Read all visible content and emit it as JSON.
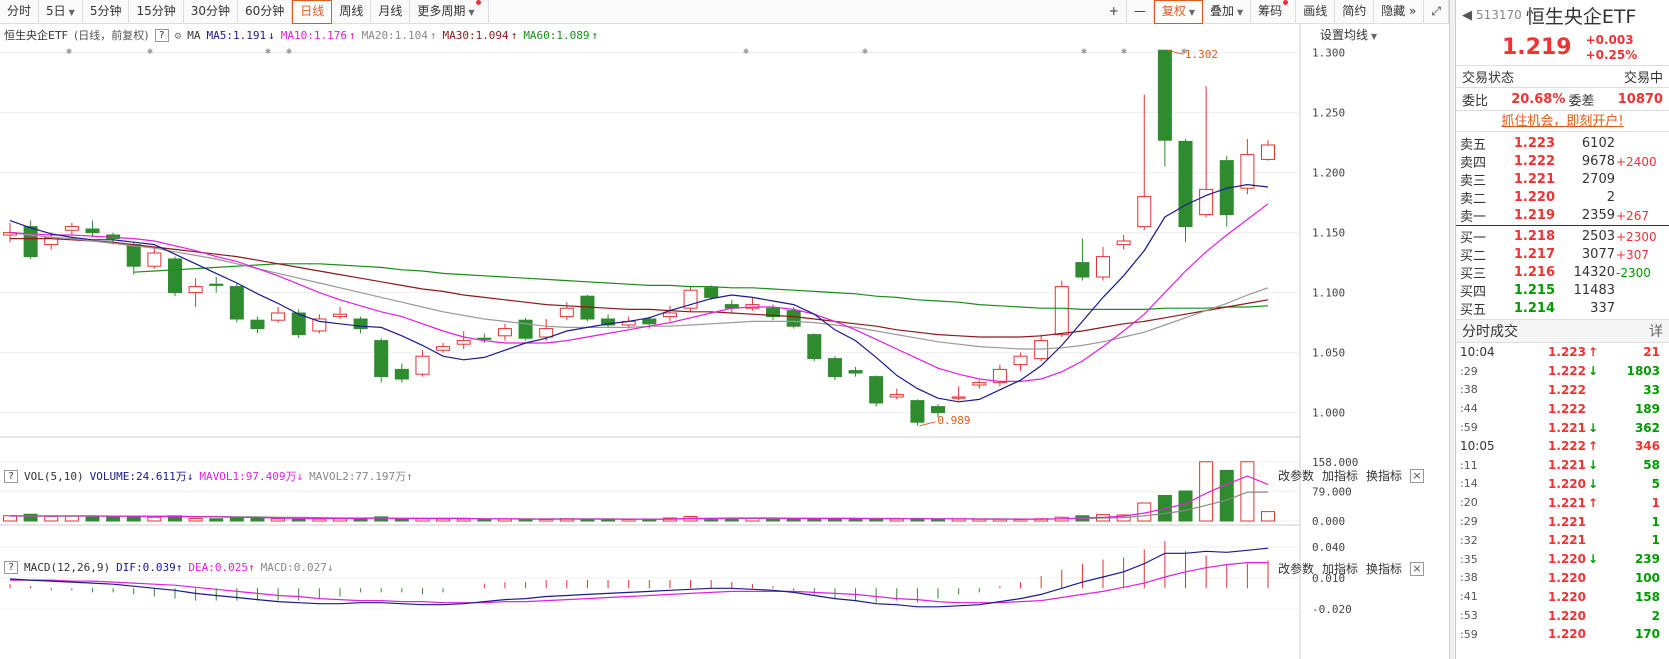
{
  "toolbar": {
    "periods": [
      "分时",
      "5日",
      "5分钟",
      "15分钟",
      "30分钟",
      "60分钟",
      "日线",
      "周线",
      "月线",
      "更多周期"
    ],
    "active_period": "日线",
    "right_buttons": [
      "+",
      "—",
      "复权",
      "叠加",
      "筹码",
      "画线",
      "简约",
      "隐藏"
    ]
  },
  "legend": {
    "name": "恒生央企ETF",
    "meta": "(日线，前复权)",
    "ma_label": "MA",
    "ma5": "MA5:1.191",
    "ma5_arrow": "↓",
    "ma10": "MA10:1.176",
    "ma10_arrow": "↑",
    "ma20": "MA20:1.104",
    "ma20_arrow": "↑",
    "ma30": "MA30:1.094",
    "ma30_arrow": "↑",
    "ma60": "MA60:1.089",
    "ma60_arrow": "↑",
    "set_ma": "设置均线"
  },
  "vol_panel": {
    "name": "VOL(5,10)",
    "volume": "VOLUME:24.611万",
    "volume_arrow": "↓",
    "mavol1": "MAVOL1:97.409万",
    "mavol1_arrow": "↓",
    "mavol2": "MAVOL2:77.197万",
    "mavol2_arrow": "↑",
    "axis": [
      "158.000",
      "79.000",
      "0.000"
    ]
  },
  "macd_panel": {
    "name": "MACD(12,26,9)",
    "dif": "DIF:0.039",
    "dif_arrow": "↑",
    "dea": "DEA:0.025",
    "dea_arrow": "↑",
    "macd": "MACD:0.027",
    "macd_arrow": "↓",
    "axis": [
      "0.040",
      "0.010",
      "-0.020"
    ]
  },
  "sub_actions": {
    "params": "改参数",
    "add": "加指标",
    "switch": "换指标",
    "close": "×"
  },
  "chart_data": {
    "type": "candlestick",
    "price_axis": [
      "1.300",
      "1.250",
      "1.200",
      "1.150",
      "1.100",
      "1.050",
      "1.000"
    ],
    "ylim": [
      0.983,
      1.308
    ],
    "high_label": "1.302",
    "low_label": "0.989",
    "candles": [
      [
        1.148,
        1.15,
        1.158,
        1.142
      ],
      [
        1.155,
        1.13,
        1.16,
        1.128
      ],
      [
        1.14,
        1.146,
        1.15,
        1.136
      ],
      [
        1.152,
        1.155,
        1.158,
        1.148
      ],
      [
        1.153,
        1.15,
        1.16,
        1.146
      ],
      [
        1.148,
        1.145,
        1.15,
        1.14
      ],
      [
        1.14,
        1.122,
        1.142,
        1.115
      ],
      [
        1.122,
        1.133,
        1.138,
        1.12
      ],
      [
        1.128,
        1.1,
        1.13,
        1.097
      ],
      [
        1.1,
        1.105,
        1.112,
        1.088
      ],
      [
        1.107,
        1.106,
        1.113,
        1.1
      ],
      [
        1.105,
        1.078,
        1.108,
        1.075
      ],
      [
        1.077,
        1.07,
        1.08,
        1.066
      ],
      [
        1.077,
        1.083,
        1.088,
        1.075
      ],
      [
        1.083,
        1.065,
        1.086,
        1.062
      ],
      [
        1.068,
        1.078,
        1.082,
        1.066
      ],
      [
        1.08,
        1.082,
        1.088,
        1.078
      ],
      [
        1.078,
        1.07,
        1.08,
        1.066
      ],
      [
        1.06,
        1.03,
        1.062,
        1.025
      ],
      [
        1.036,
        1.028,
        1.041,
        1.025
      ],
      [
        1.032,
        1.047,
        1.052,
        1.03
      ],
      [
        1.052,
        1.055,
        1.058,
        1.05
      ],
      [
        1.057,
        1.06,
        1.068,
        1.053
      ],
      [
        1.062,
        1.061,
        1.066,
        1.058
      ],
      [
        1.064,
        1.07,
        1.074,
        1.06
      ],
      [
        1.077,
        1.062,
        1.079,
        1.06
      ],
      [
        1.063,
        1.07,
        1.078,
        1.06
      ],
      [
        1.08,
        1.087,
        1.092,
        1.077
      ],
      [
        1.097,
        1.078,
        1.098,
        1.076
      ],
      [
        1.078,
        1.073,
        1.082,
        1.071
      ],
      [
        1.073,
        1.076,
        1.08,
        1.07
      ],
      [
        1.078,
        1.074,
        1.08,
        1.07
      ],
      [
        1.08,
        1.083,
        1.089,
        1.076
      ],
      [
        1.087,
        1.102,
        1.105,
        1.084
      ],
      [
        1.104,
        1.096,
        1.106,
        1.094
      ],
      [
        1.09,
        1.087,
        1.094,
        1.083
      ],
      [
        1.087,
        1.09,
        1.096,
        1.085
      ],
      [
        1.087,
        1.08,
        1.09,
        1.077
      ],
      [
        1.085,
        1.072,
        1.088,
        1.07
      ],
      [
        1.065,
        1.045,
        1.066,
        1.043
      ],
      [
        1.045,
        1.03,
        1.047,
        1.027
      ],
      [
        1.035,
        1.033,
        1.038,
        1.03
      ],
      [
        1.03,
        1.008,
        1.031,
        1.005
      ],
      [
        1.013,
        1.015,
        1.02,
        1.011
      ],
      [
        1.01,
        0.992,
        1.011,
        0.989
      ],
      [
        1.005,
        1.0,
        1.007,
        0.996
      ],
      [
        1.012,
        1.013,
        1.022,
        1.01
      ],
      [
        1.023,
        1.025,
        1.027,
        1.02
      ],
      [
        1.025,
        1.036,
        1.04,
        1.022
      ],
      [
        1.04,
        1.047,
        1.05,
        1.035
      ],
      [
        1.045,
        1.06,
        1.065,
        1.043
      ],
      [
        1.065,
        1.105,
        1.11,
        1.063
      ],
      [
        1.125,
        1.113,
        1.145,
        1.11
      ],
      [
        1.113,
        1.13,
        1.138,
        1.11
      ],
      [
        1.14,
        1.143,
        1.148,
        1.136
      ],
      [
        1.155,
        1.18,
        1.265,
        1.152
      ],
      [
        1.302,
        1.227,
        1.302,
        1.205
      ],
      [
        1.226,
        1.155,
        1.228,
        1.142
      ],
      [
        1.165,
        1.186,
        1.272,
        1.163
      ],
      [
        1.21,
        1.165,
        1.214,
        1.155
      ],
      [
        1.187,
        1.215,
        1.228,
        1.182
      ],
      [
        1.211,
        1.223,
        1.227,
        1.21
      ]
    ],
    "ma5": [
      1.16,
      1.154,
      1.149,
      1.146,
      1.144,
      1.144,
      1.142,
      1.14,
      1.132,
      1.124,
      1.116,
      1.108,
      1.099,
      1.091,
      1.082,
      1.076,
      1.074,
      1.072,
      1.071,
      1.064,
      1.056,
      1.047,
      1.044,
      1.046,
      1.052,
      1.058,
      1.062,
      1.068,
      1.071,
      1.074,
      1.076,
      1.079,
      1.085,
      1.09,
      1.095,
      1.098,
      1.096,
      1.093,
      1.09,
      1.082,
      1.069,
      1.06,
      1.046,
      1.031,
      1.02,
      1.012,
      1.009,
      1.011,
      1.019,
      1.027,
      1.039,
      1.056,
      1.076,
      1.096,
      1.114,
      1.135,
      1.163,
      1.173,
      1.181,
      1.187,
      1.19,
      1.188
    ],
    "ma10": [
      1.15,
      1.149,
      1.148,
      1.148,
      1.147,
      1.146,
      1.145,
      1.143,
      1.139,
      1.135,
      1.13,
      1.126,
      1.12,
      1.114,
      1.107,
      1.1,
      1.094,
      1.089,
      1.084,
      1.08,
      1.074,
      1.068,
      1.063,
      1.06,
      1.058,
      1.058,
      1.058,
      1.06,
      1.063,
      1.066,
      1.069,
      1.072,
      1.075,
      1.079,
      1.083,
      1.087,
      1.088,
      1.088,
      1.086,
      1.082,
      1.076,
      1.069,
      1.061,
      1.053,
      1.045,
      1.037,
      1.032,
      1.028,
      1.026,
      1.026,
      1.028,
      1.034,
      1.043,
      1.055,
      1.068,
      1.082,
      1.1,
      1.118,
      1.134,
      1.148,
      1.161,
      1.174
    ],
    "ma20": [
      1.15,
      1.148,
      1.146,
      1.145,
      1.143,
      1.141,
      1.139,
      1.137,
      1.134,
      1.131,
      1.128,
      1.124,
      1.12,
      1.116,
      1.112,
      1.108,
      1.104,
      1.1,
      1.096,
      1.092,
      1.088,
      1.084,
      1.081,
      1.078,
      1.076,
      1.074,
      1.072,
      1.071,
      1.071,
      1.071,
      1.071,
      1.072,
      1.072,
      1.073,
      1.074,
      1.075,
      1.076,
      1.076,
      1.076,
      1.075,
      1.073,
      1.071,
      1.068,
      1.065,
      1.062,
      1.059,
      1.057,
      1.055,
      1.054,
      1.053,
      1.053,
      1.054,
      1.056,
      1.059,
      1.063,
      1.067,
      1.073,
      1.079,
      1.085,
      1.091,
      1.098,
      1.104
    ],
    "ma30": [
      1.145,
      1.145,
      1.145,
      1.144,
      1.143,
      1.142,
      1.14,
      1.138,
      1.136,
      1.134,
      1.132,
      1.13,
      1.127,
      1.124,
      1.121,
      1.118,
      1.115,
      1.112,
      1.109,
      1.106,
      1.103,
      1.101,
      1.098,
      1.096,
      1.094,
      1.092,
      1.09,
      1.089,
      1.088,
      1.087,
      1.086,
      1.086,
      1.085,
      1.084,
      1.084,
      1.083,
      1.082,
      1.081,
      1.08,
      1.078,
      1.076,
      1.074,
      1.072,
      1.069,
      1.067,
      1.065,
      1.064,
      1.063,
      1.063,
      1.063,
      1.064,
      1.066,
      1.068,
      1.071,
      1.074,
      1.076,
      1.079,
      1.082,
      1.085,
      1.088,
      1.091,
      1.094
    ],
    "ma60": [
      null,
      null,
      null,
      null,
      null,
      null,
      1.117,
      1.118,
      1.119,
      1.12,
      1.121,
      1.122,
      1.123,
      1.124,
      1.124,
      1.124,
      1.123,
      1.122,
      1.121,
      1.119,
      1.118,
      1.116,
      1.115,
      1.114,
      1.113,
      1.112,
      1.111,
      1.11,
      1.109,
      1.108,
      1.107,
      1.106,
      1.106,
      1.105,
      1.105,
      1.104,
      1.104,
      1.103,
      1.102,
      1.101,
      1.1,
      1.099,
      1.097,
      1.096,
      1.094,
      1.093,
      1.092,
      1.09,
      1.089,
      1.088,
      1.087,
      1.087,
      1.086,
      1.086,
      1.086,
      1.086,
      1.087,
      1.087,
      1.087,
      1.088,
      1.088,
      1.089
    ],
    "volume": [
      14,
      18,
      12,
      13,
      11,
      11,
      13,
      10,
      14,
      7,
      6,
      8,
      9,
      6,
      6,
      5,
      6,
      7,
      11,
      6,
      6,
      5,
      5,
      5,
      5,
      4,
      4,
      6,
      5,
      5,
      4,
      5,
      8,
      12,
      7,
      6,
      7,
      7,
      7,
      6,
      6,
      6,
      5,
      5,
      7,
      5,
      5,
      5,
      5,
      4,
      6,
      10,
      14,
      17,
      16,
      48,
      68,
      80,
      158,
      135,
      158,
      25
    ],
    "volume_ylim": [
      0,
      160
    ],
    "mavol1": [
      14,
      14,
      14,
      14,
      14,
      13,
      13,
      12,
      12,
      11,
      11,
      10,
      9,
      8,
      7,
      7,
      7,
      7,
      8,
      7,
      7,
      7,
      7,
      6,
      6,
      5,
      5,
      5,
      5,
      5,
      5,
      5,
      5,
      7,
      7,
      8,
      8,
      8,
      7,
      7,
      7,
      7,
      6,
      6,
      6,
      6,
      6,
      5,
      5,
      5,
      5,
      6,
      8,
      10,
      13,
      21,
      33,
      46,
      74,
      98,
      120,
      97
    ],
    "mavol2": [
      13,
      13,
      13,
      13,
      13,
      13,
      13,
      13,
      13,
      12,
      12,
      11,
      11,
      10,
      10,
      9,
      8,
      8,
      8,
      7,
      7,
      7,
      7,
      6,
      6,
      6,
      6,
      6,
      6,
      6,
      5,
      5,
      5,
      6,
      6,
      7,
      7,
      7,
      7,
      7,
      7,
      7,
      7,
      7,
      6,
      6,
      6,
      6,
      6,
      5,
      5,
      6,
      7,
      8,
      9,
      14,
      20,
      28,
      42,
      56,
      77,
      77
    ],
    "macd_ylim": [
      -0.026,
      0.046
    ],
    "dif": [
      0.009,
      0.008,
      0.007,
      0.006,
      0.005,
      0.004,
      0.002,
      0.0,
      -0.002,
      -0.005,
      -0.007,
      -0.009,
      -0.011,
      -0.013,
      -0.014,
      -0.015,
      -0.015,
      -0.014,
      -0.014,
      -0.015,
      -0.016,
      -0.016,
      -0.015,
      -0.013,
      -0.011,
      -0.01,
      -0.008,
      -0.007,
      -0.006,
      -0.005,
      -0.004,
      -0.003,
      -0.002,
      -0.001,
      0.0,
      0.0,
      -0.001,
      -0.002,
      -0.004,
      -0.007,
      -0.01,
      -0.012,
      -0.015,
      -0.016,
      -0.018,
      -0.018,
      -0.017,
      -0.016,
      -0.013,
      -0.01,
      -0.006,
      0.0,
      0.006,
      0.011,
      0.016,
      0.024,
      0.034,
      0.034,
      0.036,
      0.035,
      0.037,
      0.039
    ],
    "dea": [
      0.008,
      0.008,
      0.008,
      0.007,
      0.007,
      0.006,
      0.005,
      0.004,
      0.003,
      0.001,
      -0.001,
      -0.003,
      -0.005,
      -0.007,
      -0.008,
      -0.01,
      -0.011,
      -0.012,
      -0.012,
      -0.013,
      -0.013,
      -0.014,
      -0.014,
      -0.014,
      -0.013,
      -0.013,
      -0.012,
      -0.011,
      -0.01,
      -0.009,
      -0.008,
      -0.007,
      -0.006,
      -0.005,
      -0.004,
      -0.003,
      -0.003,
      -0.003,
      -0.003,
      -0.004,
      -0.005,
      -0.006,
      -0.008,
      -0.01,
      -0.011,
      -0.013,
      -0.014,
      -0.014,
      -0.014,
      -0.013,
      -0.012,
      -0.009,
      -0.006,
      -0.003,
      0.001,
      0.005,
      0.011,
      0.016,
      0.02,
      0.023,
      0.025,
      0.025
    ],
    "macd_hist": [
      0.004,
      0.002,
      -0.002,
      -0.002,
      -0.004,
      -0.004,
      -0.006,
      -0.008,
      -0.01,
      -0.012,
      -0.012,
      -0.012,
      -0.012,
      -0.012,
      -0.012,
      -0.01,
      -0.008,
      -0.004,
      -0.004,
      -0.004,
      -0.006,
      -0.004,
      0.0,
      0.004,
      0.006,
      0.006,
      0.008,
      0.008,
      0.008,
      0.008,
      0.008,
      0.008,
      0.008,
      0.008,
      0.008,
      0.006,
      0.004,
      0.002,
      -0.002,
      -0.006,
      -0.01,
      -0.012,
      -0.014,
      -0.012,
      -0.014,
      -0.01,
      -0.006,
      -0.004,
      0.002,
      0.006,
      0.012,
      0.018,
      0.024,
      0.028,
      0.03,
      0.038,
      0.046,
      0.036,
      0.032,
      0.024,
      0.024,
      0.027
    ]
  },
  "quote": {
    "code": "513170",
    "name": "恒生央企ETF",
    "price": "1.219",
    "change": "+0.003",
    "change_pct": "+0.25%",
    "status_label": "交易状态",
    "status_value": "交易中",
    "ratio_label": "委比",
    "ratio_value": "20.68%",
    "diff_label": "委差",
    "diff_value": "10870",
    "promo": "抓住机会，即刻开户!"
  },
  "order_book": {
    "asks": [
      {
        "label": "卖五",
        "price": "1.223",
        "vol": "6102",
        "delta": ""
      },
      {
        "label": "卖四",
        "price": "1.222",
        "vol": "9678",
        "delta": "+2400"
      },
      {
        "label": "卖三",
        "price": "1.221",
        "vol": "2709",
        "delta": ""
      },
      {
        "label": "卖二",
        "price": "1.220",
        "vol": "2",
        "delta": ""
      },
      {
        "label": "卖一",
        "price": "1.219",
        "vol": "2359",
        "delta": "+267"
      }
    ],
    "bids": [
      {
        "label": "买一",
        "price": "1.218",
        "vol": "2503",
        "delta": "+2300"
      },
      {
        "label": "买二",
        "price": "1.217",
        "vol": "3077",
        "delta": "+307"
      },
      {
        "label": "买三",
        "price": "1.216",
        "vol": "14320",
        "delta": "-2300"
      },
      {
        "label": "买四",
        "price": "1.215",
        "vol": "11483",
        "delta": ""
      },
      {
        "label": "买五",
        "price": "1.214",
        "vol": "337",
        "delta": ""
      }
    ]
  },
  "ticks": {
    "title": "分时成交",
    "detail": "详",
    "rows": [
      {
        "time": "10:04",
        "price": "1.223",
        "dir": "up",
        "vol": "21"
      },
      {
        "time": ":29",
        "price": "1.222",
        "dir": "down",
        "vol": "1803"
      },
      {
        "time": ":38",
        "price": "1.222",
        "dir": "",
        "vol": "33"
      },
      {
        "time": ":44",
        "price": "1.222",
        "dir": "",
        "vol": "189"
      },
      {
        "time": ":59",
        "price": "1.221",
        "dir": "down",
        "vol": "362"
      },
      {
        "time": "10:05",
        "price": "1.222",
        "dir": "up",
        "vol": "346"
      },
      {
        "time": ":11",
        "price": "1.221",
        "dir": "down",
        "vol": "58"
      },
      {
        "time": ":14",
        "price": "1.220",
        "dir": "down",
        "vol": "5"
      },
      {
        "time": ":20",
        "price": "1.221",
        "dir": "up",
        "vol": "1"
      },
      {
        "time": ":29",
        "price": "1.221",
        "dir": "",
        "vol": "1"
      },
      {
        "time": ":32",
        "price": "1.221",
        "dir": "",
        "vol": "1"
      },
      {
        "time": ":35",
        "price": "1.220",
        "dir": "down",
        "vol": "239"
      },
      {
        "time": ":38",
        "price": "1.220",
        "dir": "",
        "vol": "100"
      },
      {
        "time": ":41",
        "price": "1.220",
        "dir": "",
        "vol": "158"
      },
      {
        "time": ":53",
        "price": "1.220",
        "dir": "",
        "vol": "2"
      },
      {
        "time": ":59",
        "price": "1.220",
        "dir": "",
        "vol": "170"
      }
    ]
  },
  "colors": {
    "up": "#e33333",
    "down": "#2e8b2e",
    "ma5": "#1a1a8c",
    "ma10": "#e020e0",
    "ma20": "#999999",
    "ma30": "#8b1a1a",
    "ma60": "#1a8c1a",
    "accent": "#e25a1b"
  }
}
